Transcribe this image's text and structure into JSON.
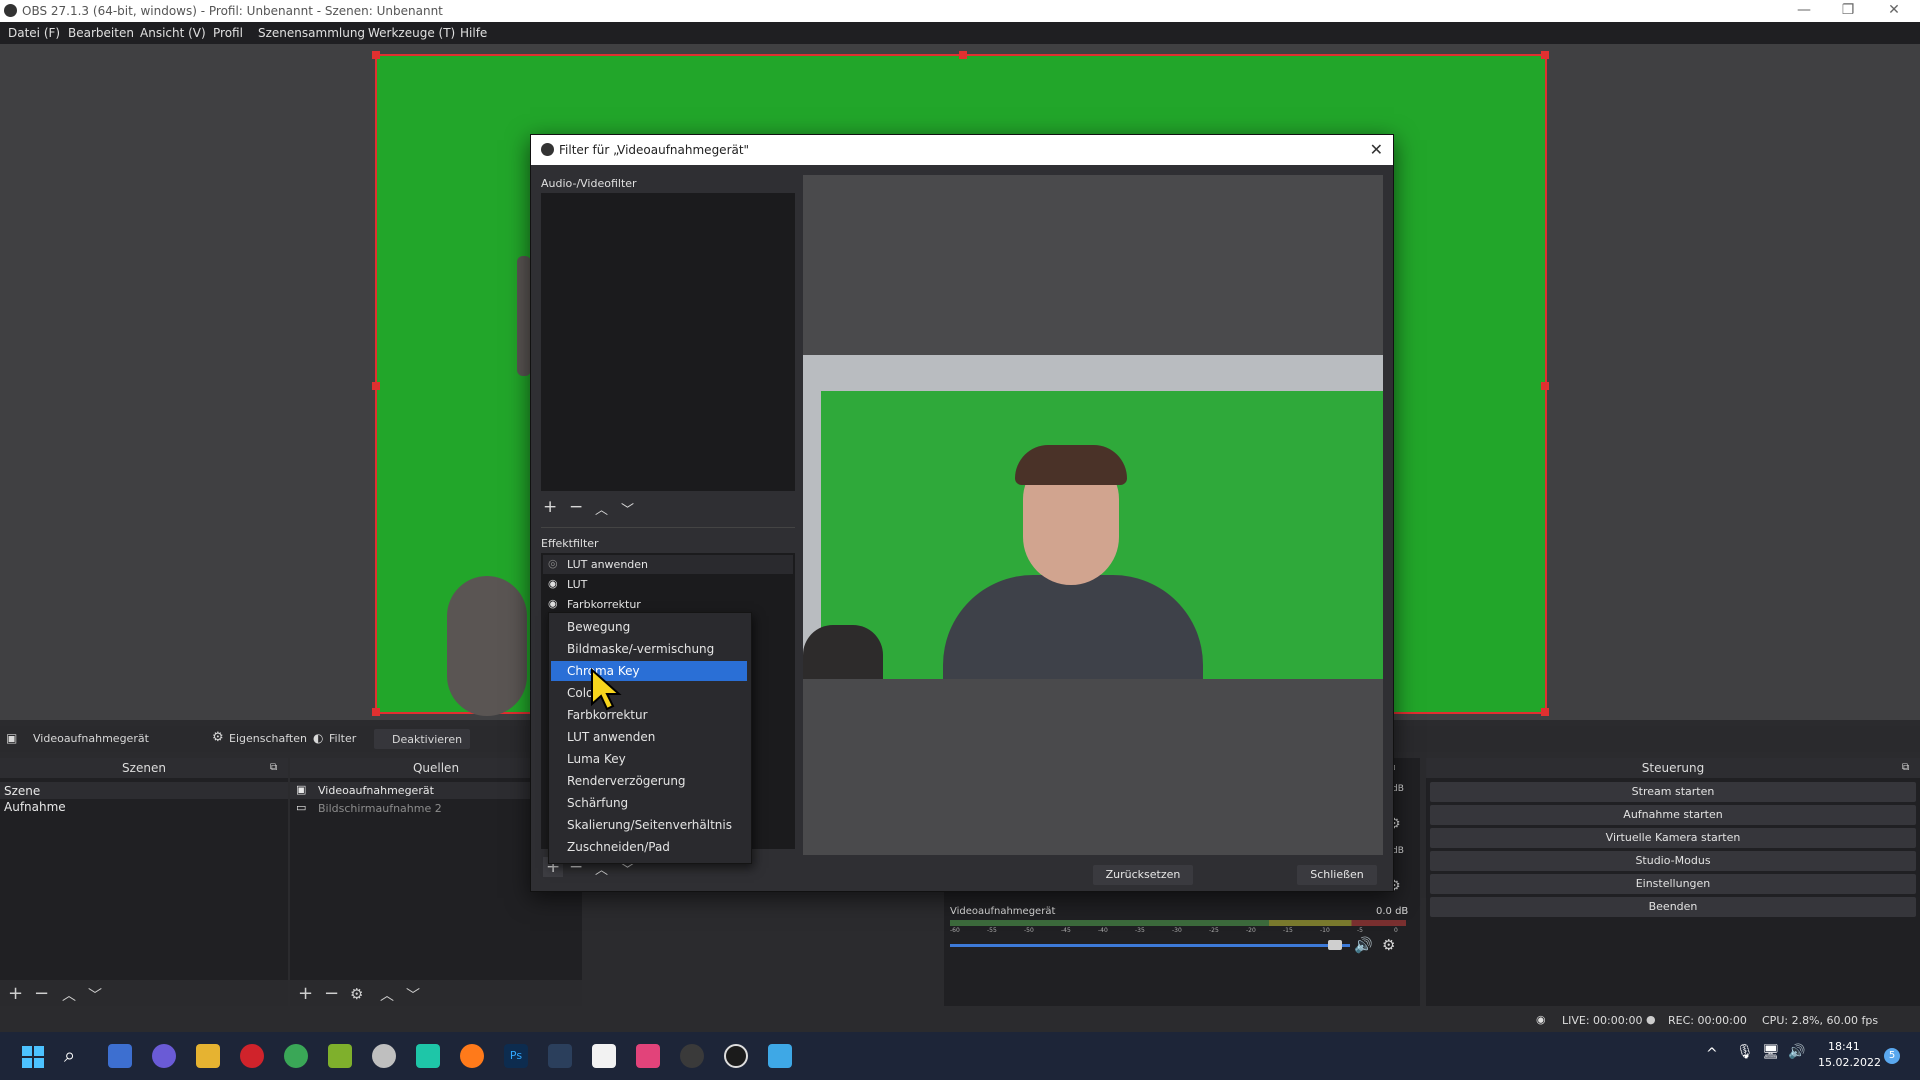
{
  "window": {
    "title": "OBS 27.1.3 (64-bit, windows) - Profil: Unbenannt - Szenen: Unbenannt"
  },
  "menu": [
    "Datei (F)",
    "Bearbeiten",
    "Ansicht (V)",
    "Profil",
    "Szenensammlung",
    "Werkzeuge (T)",
    "Hilfe"
  ],
  "source_toolbar": {
    "source": "Videoaufnahmegerät",
    "properties": "Eigenschaften",
    "filter": "Filter",
    "deactivate": "Deaktivieren"
  },
  "scenes": {
    "header": "Szenen",
    "items": [
      "Szene",
      "Aufnahme"
    ]
  },
  "sources": {
    "header": "Quellen",
    "items": [
      "Videoaufnahmegerät",
      "Bildschirmaufnahme 2"
    ]
  },
  "controls": {
    "header": "Steuerung",
    "buttons": [
      "Stream starten",
      "Aufnahme starten",
      "Virtuelle Kamera starten",
      "Studio-Modus",
      "Einstellungen",
      "Beenden"
    ]
  },
  "mixer": {
    "label": "Videoaufnahmegerät",
    "db": "0.0 dB",
    "db_small": "dB",
    "ticks": [
      "-60",
      "-55",
      "-50",
      "-45",
      "-40",
      "-35",
      "-30",
      "-25",
      "-20",
      "-15",
      "-10",
      "-5",
      "0"
    ]
  },
  "status": {
    "live": "LIVE: 00:00:00",
    "rec": "REC: 00:00:00",
    "cpu": "CPU: 2.8%, 60.00 fps"
  },
  "taskbar": {
    "time": "18:41",
    "date": "15.02.2022",
    "notif": "5"
  },
  "dialog": {
    "title": "Filter für „Videoaufnahmegerät\"",
    "av_section": "Audio-/Videofilter",
    "effect_section": "Effektfilter",
    "effect_items": [
      "LUT anwenden",
      "LUT",
      "Farbkorrektur"
    ],
    "reset": "Zurücksetzen",
    "close": "Schließen"
  },
  "context_menu": {
    "items": [
      "Bewegung",
      "Bildmaske/-vermischung",
      "Chroma Key",
      "Color",
      "Farbkorrektur",
      "LUT anwenden",
      "Luma Key",
      "Renderverzögerung",
      "Schärfung",
      "Skalierung/Seitenverhältnis",
      "Zuschneiden/Pad"
    ],
    "selected": 2
  },
  "colors": {
    "green_screen": "#22a62a",
    "selection": "#2a6fd6",
    "handle": "#e03030"
  }
}
